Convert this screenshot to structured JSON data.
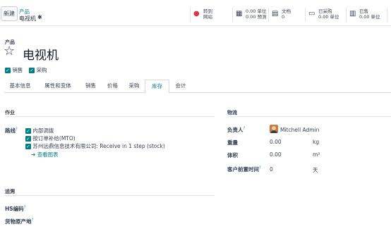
{
  "header": {
    "new_label": "新建",
    "breadcrumb_parent": "产品",
    "breadcrumb_current": "电视机"
  },
  "stats": [
    {
      "icon": "globe-icon",
      "line1": "转到",
      "line2": "网站"
    },
    {
      "icon": "cubes-icon",
      "line1": "0.00 单位",
      "line2": "0.00 预测"
    },
    {
      "icon": "file-icon",
      "line1": "文档",
      "line2": "0"
    },
    {
      "icon": "credit-card-icon",
      "line1": "已采购",
      "line2": "0.00 单位"
    },
    {
      "icon": "signal-icon",
      "line1": "已售",
      "line2": "0.00 单位"
    }
  ],
  "product": {
    "label": "产品",
    "name": "电视机",
    "sale_label": "销售",
    "purchase_label": "采购"
  },
  "tabs": [
    "基本信息",
    "属性和变体",
    "销售",
    "价格",
    "采购",
    "库存",
    "会计"
  ],
  "operations": {
    "title": "作业",
    "routes_label": "路线",
    "routes": [
      "内部调拨",
      "按订单补给(MTO)",
      "苏州远鼎信息技术有限公司: Receive in 1 step (stock)"
    ],
    "view_diagram": "查看图表"
  },
  "logistics": {
    "title": "物流",
    "responsible_label": "负责人",
    "responsible_value": "Mitchell Admin",
    "weight_label": "重量",
    "weight_value": "0.00",
    "weight_unit": "kg",
    "volume_label": "体积",
    "volume_value": "0.00",
    "volume_unit": "m³",
    "lead_time_label": "客户前置时间",
    "lead_time_value": "0",
    "lead_time_unit": "天"
  },
  "tracking": {
    "title": "追溯",
    "hs_label": "HS编码",
    "origin_label": "货物原产地"
  }
}
